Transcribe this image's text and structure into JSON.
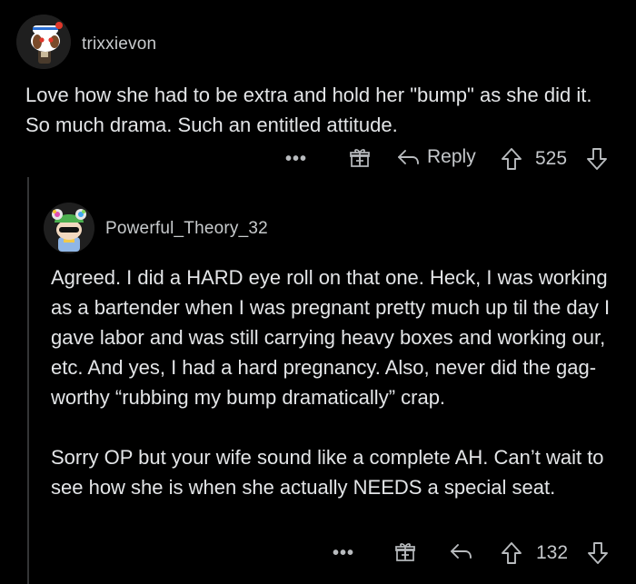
{
  "comments": [
    {
      "username": "trixxievon",
      "avatar_icon": "snoo-sailor-avatar-icon",
      "body": "Love how she had to be extra and hold her \"bump\" as she did it. So much drama. Such an entitled attitude.",
      "more_label": "•••",
      "gift_icon": "gift-icon",
      "reply_label": "Reply",
      "upvote_icon": "upvote-arrow-icon",
      "score": "525",
      "downvote_icon": "downvote-arrow-icon"
    },
    {
      "username": "Powerful_Theory_32",
      "avatar_icon": "snoo-frog-hat-avatar-icon",
      "paragraphs": [
        "Agreed. I did a HARD eye roll on that one. Heck, I was working as a bartender when I was pregnant pretty much up til the day I gave labor and was still carrying heavy boxes and working our, etc. And yes, I had a hard pregnancy. Also, never did the gag-worthy “rubbing my bump dramatically” crap.",
        "Sorry OP but your wife sound like a complete AH. Can’t wait to see how she is when she actually NEEDS a special seat."
      ],
      "more_label": "•••",
      "gift_icon": "gift-icon",
      "reply_icon": "reply-arrow-icon",
      "upvote_icon": "upvote-arrow-icon",
      "score": "132",
      "downvote_icon": "downvote-arrow-icon"
    }
  ],
  "colors": {
    "background": "#000000",
    "text": "#e3e5e7",
    "muted": "#b8bbbe"
  }
}
